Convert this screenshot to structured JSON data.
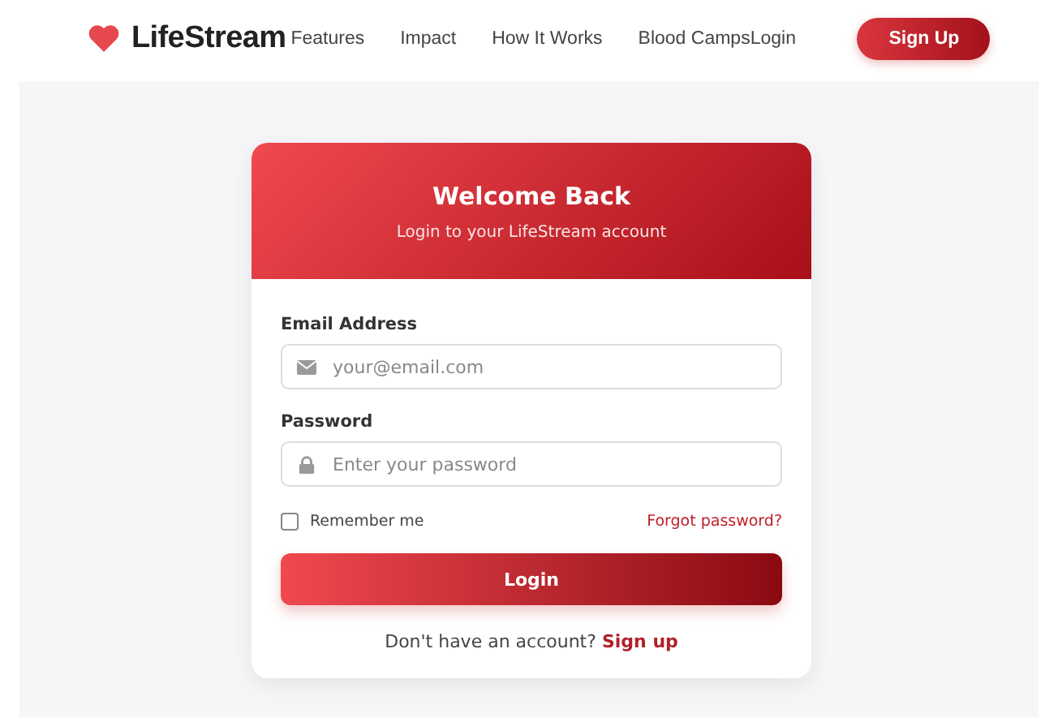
{
  "nav": {
    "brand": "LifeStream",
    "links": [
      "Features",
      "Impact",
      "How It Works",
      "Blood Camps",
      "Login"
    ],
    "signup": "Sign Up"
  },
  "card": {
    "title": "Welcome Back",
    "subtitle": "Login to your LifeStream account",
    "fields": [
      {
        "kind": "email",
        "label": "Email Address",
        "placeholder": "your@email.com"
      },
      {
        "kind": "password",
        "label": "Password",
        "placeholder": "Enter your password"
      }
    ],
    "remember": {
      "label": "Remember me",
      "checked": false
    },
    "forgot": "Forgot password?",
    "submit": "Login",
    "footer_text": "Don't have an account?",
    "footer_link": "Sign up"
  }
}
